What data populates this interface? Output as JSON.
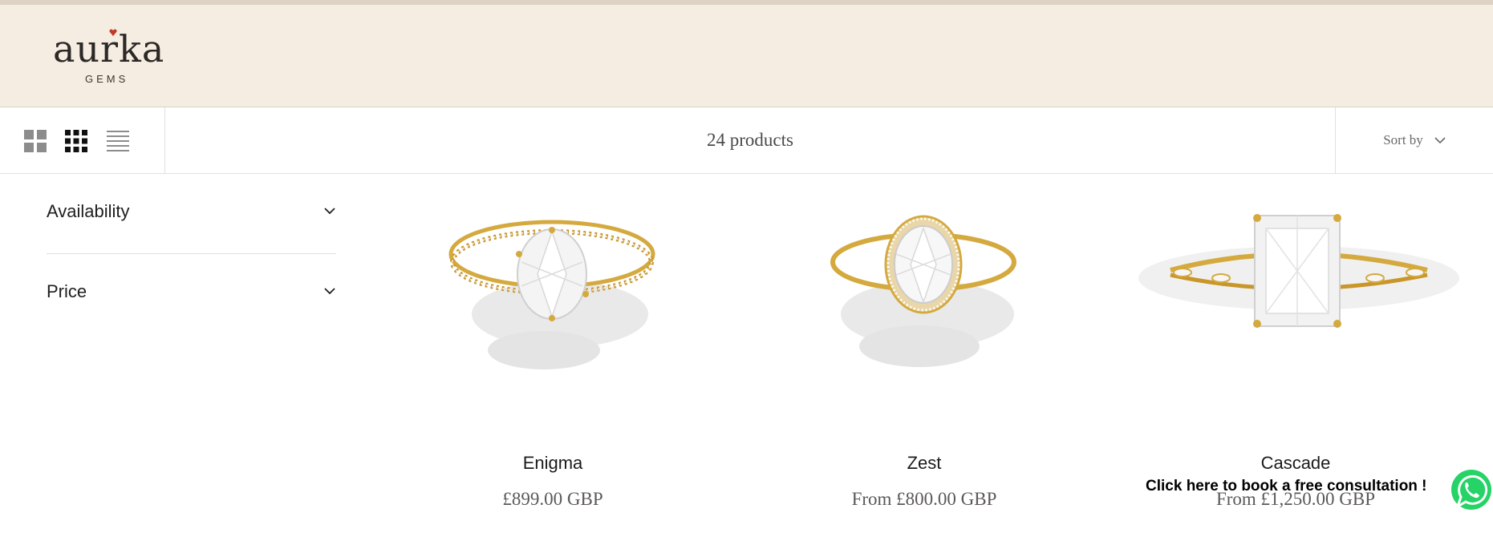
{
  "brand": {
    "logo_word": "aurka",
    "logo_sub": "GEMS",
    "colors": {
      "header_bg": "#f5ede1",
      "gem": "#c0392b",
      "gold": "#d4a93e"
    }
  },
  "toolbar": {
    "layout_options": [
      "grid-2-icon",
      "grid-4-icon",
      "list-icon"
    ],
    "product_count": "24 products",
    "sort_label": "Sort by"
  },
  "filters": [
    {
      "label": "Availability"
    },
    {
      "label": "Price"
    }
  ],
  "products": [
    {
      "name": "Enigma",
      "price": "£899.00 GBP"
    },
    {
      "name": "Zest",
      "price": "From £800.00 GBP"
    },
    {
      "name": "Cascade",
      "price": "From £1,250.00 GBP"
    }
  ],
  "consultation": {
    "text": "Click here to book a free consultation !",
    "icon": "whatsapp-icon",
    "color": "#25d366"
  }
}
